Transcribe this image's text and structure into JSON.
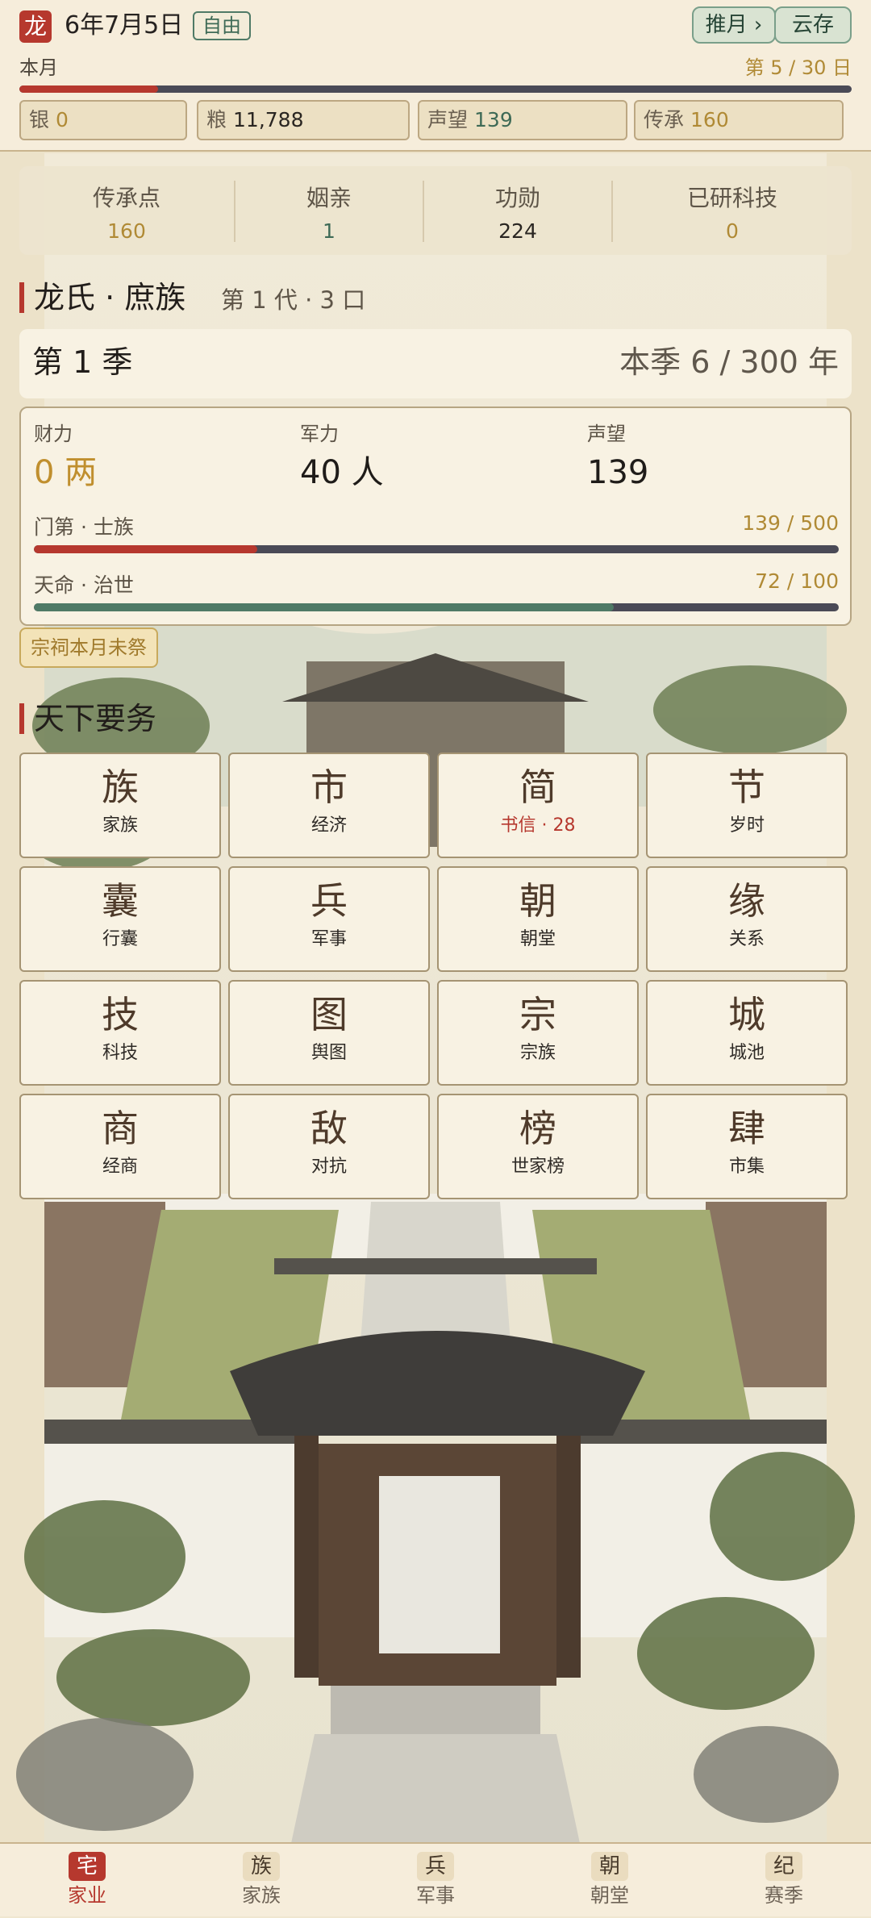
{
  "header": {
    "logo_char": "龙",
    "date": "6年7月5日",
    "mode_badge": "自由",
    "advance_button": "推月 ›",
    "cloud_save_button": "云存",
    "month_label": "本月",
    "day_progress_label": "第 5 / 30 日",
    "day_progress": 0.1667,
    "resources": [
      {
        "label": "银",
        "value": "0"
      },
      {
        "label": "粮",
        "value": "11,788"
      },
      {
        "label": "声望",
        "value": "139"
      },
      {
        "label": "传承",
        "value": "160"
      }
    ]
  },
  "stats": [
    {
      "label": "传承点",
      "value": "160"
    },
    {
      "label": "姻亲",
      "value": "1"
    },
    {
      "label": "功勋",
      "value": "224"
    },
    {
      "label": "已研科技",
      "value": "0"
    }
  ],
  "clan": {
    "name": "龙氏 · 庶族",
    "sub": "第 1 代 · 3 口"
  },
  "season": {
    "label": "第 1 季",
    "progress_text": "本季 6 / 300 年"
  },
  "power": {
    "wealth_label": "财力",
    "wealth_value": "0 两",
    "military_label": "军力",
    "military_value": "40 人",
    "prestige_label": "声望",
    "prestige_value": "139",
    "rank_label": "门第 · 士族",
    "rank_value": "139 / 500",
    "rank_progress": 0.278,
    "fate_label": "天命 · 治世",
    "fate_value": "72 / 100",
    "fate_progress": 0.72
  },
  "shrine_notice": "宗祠本月未祭",
  "affairs": {
    "title": "天下要务",
    "tiles": [
      {
        "glyph": "族",
        "label": "家族"
      },
      {
        "glyph": "市",
        "label": "经济"
      },
      {
        "glyph": "简",
        "label": "书信 · 28"
      },
      {
        "glyph": "节",
        "label": "岁时"
      },
      {
        "glyph": "囊",
        "label": "行囊"
      },
      {
        "glyph": "兵",
        "label": "军事"
      },
      {
        "glyph": "朝",
        "label": "朝堂"
      },
      {
        "glyph": "缘",
        "label": "关系"
      },
      {
        "glyph": "技",
        "label": "科技"
      },
      {
        "glyph": "图",
        "label": "舆图"
      },
      {
        "glyph": "宗",
        "label": "宗族"
      },
      {
        "glyph": "城",
        "label": "城池"
      },
      {
        "glyph": "商",
        "label": "经商"
      },
      {
        "glyph": "敌",
        "label": "对抗"
      },
      {
        "glyph": "榜",
        "label": "世家榜"
      },
      {
        "glyph": "肆",
        "label": "市集"
      }
    ]
  },
  "bottom_nav": [
    {
      "glyph": "宅",
      "label": "家业"
    },
    {
      "glyph": "族",
      "label": "家族"
    },
    {
      "glyph": "兵",
      "label": "军事"
    },
    {
      "glyph": "朝",
      "label": "朝堂"
    },
    {
      "glyph": "纪",
      "label": "赛季"
    }
  ],
  "colors": {
    "accent_red": "#b6382e",
    "gold": "#b08a35",
    "jade": "#4f7a66",
    "paper": "#f8f2e3"
  }
}
